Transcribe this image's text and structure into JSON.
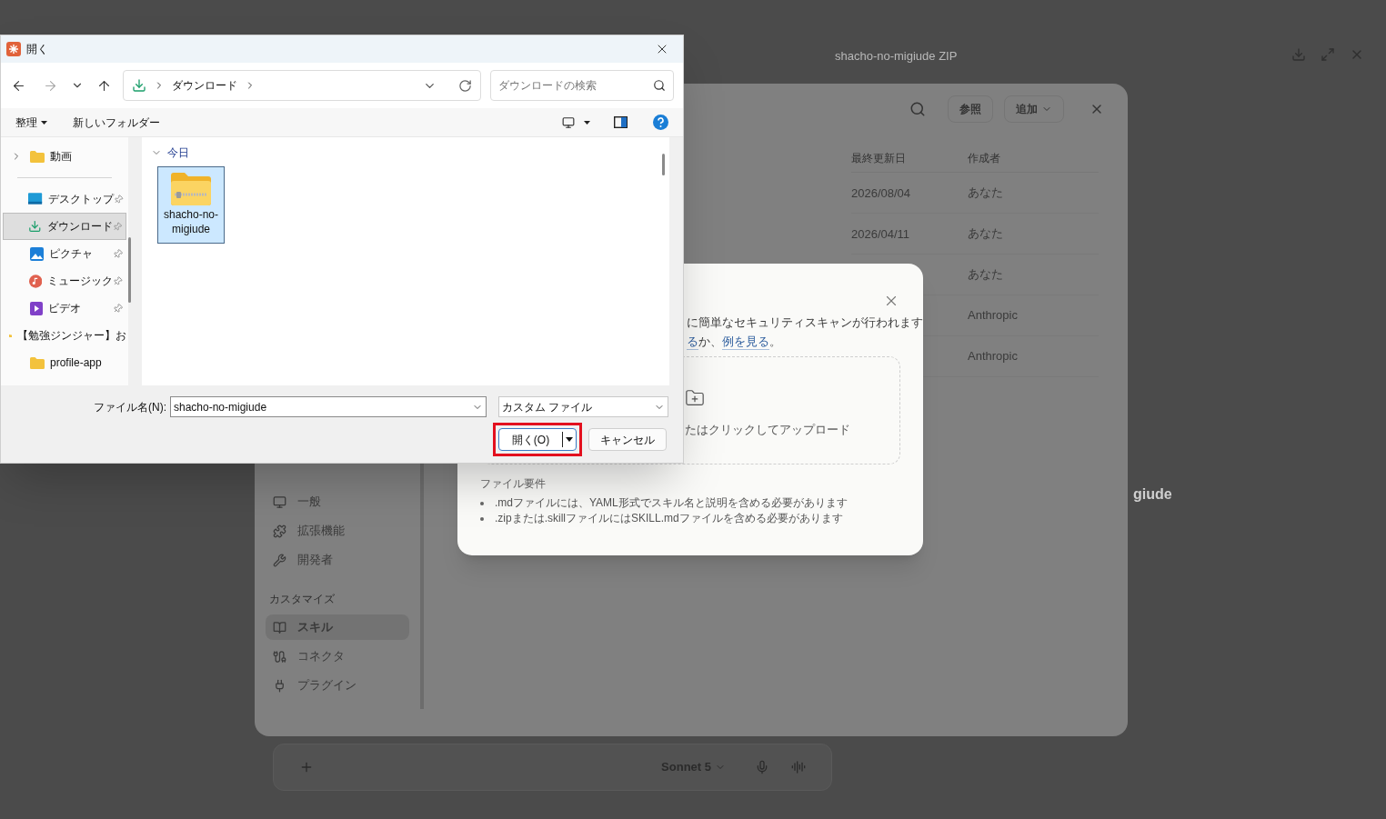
{
  "background": {
    "title": "shacho-no-migiude  ZIP",
    "side_text": "giude",
    "model": "Sonnet 5",
    "settings": {
      "nav_groups": [
        {
          "items": [
            {
              "label": "一般",
              "selected": false
            },
            {
              "label": "拡張機能",
              "selected": false
            },
            {
              "label": "開発者",
              "selected": false
            }
          ]
        },
        {
          "header": "カスタマイズ",
          "items": [
            {
              "label": "スキル",
              "selected": true
            },
            {
              "label": "コネクタ",
              "selected": false
            },
            {
              "label": "プラグイン",
              "selected": false
            }
          ]
        }
      ],
      "header_buttons": [
        {
          "label": "参照",
          "dropdown": false
        },
        {
          "label": "追加",
          "dropdown": true
        }
      ],
      "columns": [
        "最終更新日",
        "作成者"
      ],
      "rows": [
        {
          "date": "2026/08/04",
          "author": "あなた"
        },
        {
          "date": "2026/04/11",
          "author": "あなた"
        },
        {
          "author": "あなた"
        },
        {
          "author": "Anthropic"
        },
        {
          "author": "Anthropic"
        }
      ]
    }
  },
  "upload_modal": {
    "notice": "に簡単なセキュリティスキャンが行われます",
    "notice_parts": [
      {
        "text": "る",
        "link": true
      },
      {
        "text": "か、",
        "link": false
      },
      {
        "text": "例を見る",
        "link": true
      },
      {
        "text": "。",
        "link": false
      }
    ],
    "drop_text": "たはクリックしてアップロード",
    "requirements_title": "ファイル要件",
    "requirements": [
      ".mdファイルには、YAML形式でスキル名と説明を含める必要があります",
      ".zipまたは.skillファイルにはSKILL.mdファイルを含める必要があります"
    ]
  },
  "file_dialog": {
    "title": "開く",
    "forward_disabled": true,
    "path": [
      "ダウンロード"
    ],
    "search": {
      "placeholder": "ダウンロードの検索"
    },
    "commands": [
      {
        "label": "整理",
        "dropdown": true
      },
      {
        "label": "新しいフォルダー",
        "dropdown": false
      }
    ],
    "nav_pane": [
      {
        "label": "動画",
        "kind": "folder",
        "expander": true,
        "pinned": false,
        "selected": false
      },
      {
        "label": "デスクトップ",
        "kind": "desktop",
        "expander": false,
        "pinned": true,
        "selected": false
      },
      {
        "label": "ダウンロード",
        "kind": "download",
        "expander": false,
        "pinned": true,
        "selected": true
      },
      {
        "label": "ピクチャ",
        "kind": "pictures",
        "expander": false,
        "pinned": true,
        "selected": false
      },
      {
        "label": "ミュージック",
        "kind": "music",
        "expander": false,
        "pinned": true,
        "selected": false
      },
      {
        "label": "ビデオ",
        "kind": "video",
        "expander": false,
        "pinned": true,
        "selected": false
      },
      {
        "label": "【勉強ジンジャー】お",
        "kind": "folder",
        "expander": false,
        "pinned": false,
        "selected": false
      },
      {
        "label": "profile-app",
        "kind": "folder",
        "expander": false,
        "pinned": false,
        "selected": false
      }
    ],
    "group": {
      "label": "今日",
      "expanded": true
    },
    "files": [
      {
        "name": "shacho-no-migiude",
        "selected": true
      }
    ],
    "file_name_label": "ファイル名(N):",
    "file_name": "shacho-no-migiude",
    "filter": "カスタム ファイル",
    "open_button": "開く(O)",
    "cancel_button": "キャンセル",
    "highlight_open": true
  }
}
